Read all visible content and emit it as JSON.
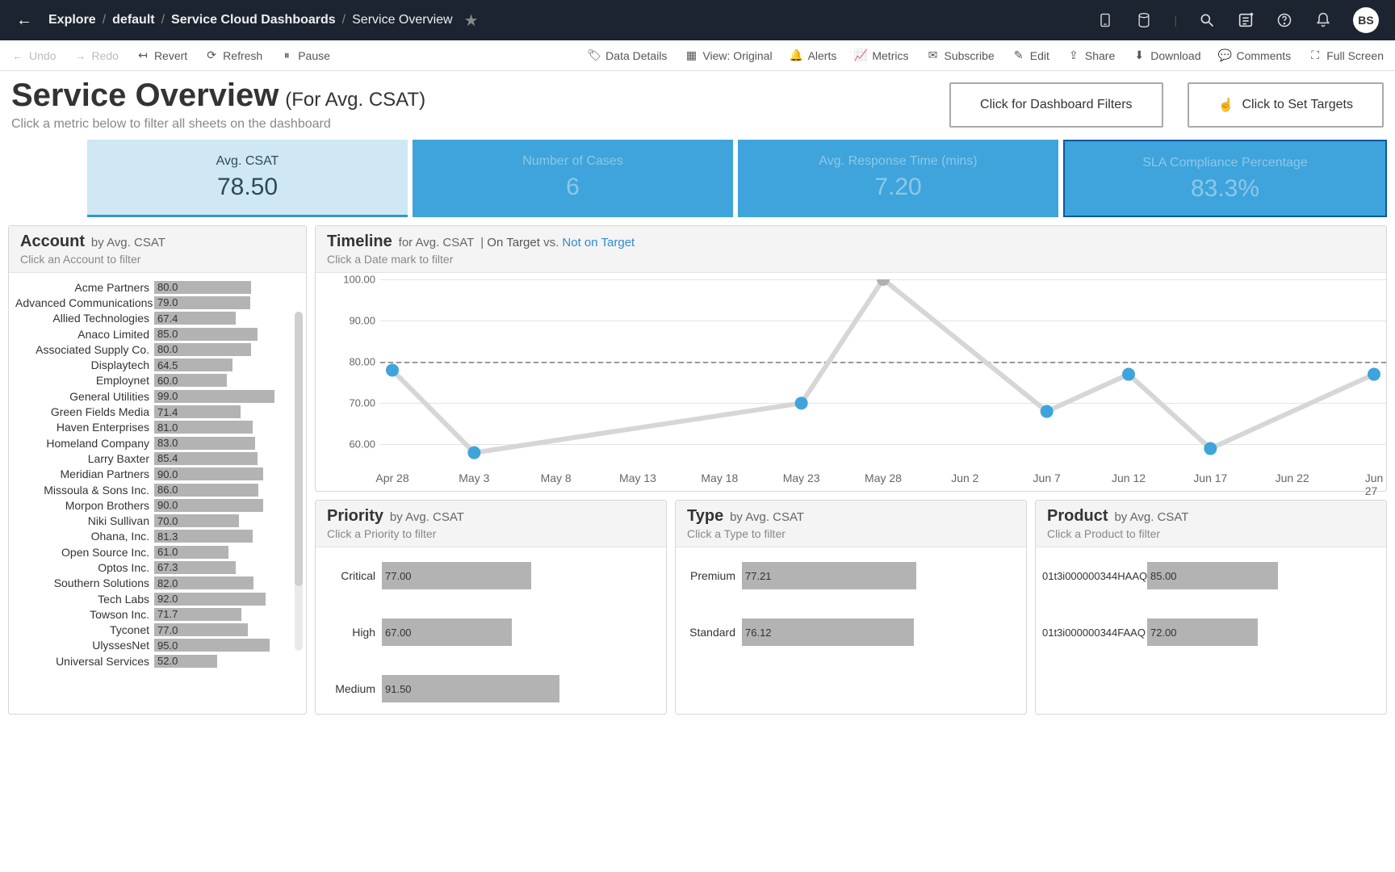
{
  "breadcrumb": {
    "explore": "Explore",
    "default": "default",
    "dash": "Service Cloud Dashboards",
    "page": "Service Overview"
  },
  "avatar": "BS",
  "toolbar": {
    "undo": "Undo",
    "redo": "Redo",
    "revert": "Revert",
    "refresh": "Refresh",
    "pause": "Pause",
    "datadetails": "Data Details",
    "view": "View: Original",
    "alerts": "Alerts",
    "metrics": "Metrics",
    "subscribe": "Subscribe",
    "edit": "Edit",
    "share": "Share",
    "download": "Download",
    "comments": "Comments",
    "fullscreen": "Full Screen"
  },
  "title": "Service Overview",
  "title_sub": "(For Avg. CSAT)",
  "title_hint": "Click a metric below to filter all sheets on the dashboard",
  "btn_filters": "Click for Dashboard Filters",
  "btn_targets": "Click to Set Targets",
  "tiles": [
    {
      "label": "Avg. CSAT",
      "value": "78.50"
    },
    {
      "label": "Number of Cases",
      "value": "6"
    },
    {
      "label": "Avg. Response Time (mins)",
      "value": "7.20"
    },
    {
      "label": "SLA Compliance Percentage",
      "value": "83.3%"
    }
  ],
  "account": {
    "title": "Account",
    "sub": "by Avg. CSAT",
    "hint": "Click an Account to filter",
    "rows": [
      {
        "name": "Acme Partners",
        "v": "80.0"
      },
      {
        "name": "Advanced Communications",
        "v": "79.0"
      },
      {
        "name": "Allied Technologies",
        "v": "67.4"
      },
      {
        "name": "Anaco Limited",
        "v": "85.0"
      },
      {
        "name": "Associated Supply Co.",
        "v": "80.0"
      },
      {
        "name": "Displaytech",
        "v": "64.5"
      },
      {
        "name": "Employnet",
        "v": "60.0"
      },
      {
        "name": "General Utilities",
        "v": "99.0"
      },
      {
        "name": "Green Fields Media",
        "v": "71.4"
      },
      {
        "name": "Haven Enterprises",
        "v": "81.0"
      },
      {
        "name": "Homeland Company",
        "v": "83.0"
      },
      {
        "name": "Larry Baxter",
        "v": "85.4"
      },
      {
        "name": "Meridian Partners",
        "v": "90.0"
      },
      {
        "name": "Missoula & Sons Inc.",
        "v": "86.0"
      },
      {
        "name": "Morpon Brothers",
        "v": "90.0"
      },
      {
        "name": "Niki Sullivan",
        "v": "70.0"
      },
      {
        "name": "Ohana, Inc.",
        "v": "81.3"
      },
      {
        "name": "Open Source Inc.",
        "v": "61.0"
      },
      {
        "name": "Optos Inc.",
        "v": "67.3"
      },
      {
        "name": "Southern Solutions",
        "v": "82.0"
      },
      {
        "name": "Tech Labs",
        "v": "92.0"
      },
      {
        "name": "Towson Inc.",
        "v": "71.7"
      },
      {
        "name": "Tyconet",
        "v": "77.0"
      },
      {
        "name": "UlyssesNet",
        "v": "95.0"
      },
      {
        "name": "Universal Services",
        "v": "52.0"
      }
    ]
  },
  "timeline": {
    "title": "Timeline",
    "sub": "for Avg. CSAT",
    "legend_on": "On Target",
    "legend_vs": "vs.",
    "legend_off": "Not on Target",
    "hint": "Click a Date mark to filter"
  },
  "priority": {
    "title": "Priority",
    "sub": "by Avg. CSAT",
    "hint": "Click a Priority to filter",
    "rows": [
      {
        "name": "Critical",
        "v": "77.00"
      },
      {
        "name": "High",
        "v": "67.00"
      },
      {
        "name": "Medium",
        "v": "91.50"
      }
    ]
  },
  "type": {
    "title": "Type",
    "sub": "by Avg. CSAT",
    "hint": "Click a Type to filter",
    "rows": [
      {
        "name": "Premium",
        "v": "77.21"
      },
      {
        "name": "Standard",
        "v": "76.12"
      }
    ]
  },
  "product": {
    "title": "Product",
    "sub": "by Avg. CSAT",
    "hint": "Click a Product to filter",
    "rows": [
      {
        "name": "01t3i000000344HAAQ",
        "v": "85.00"
      },
      {
        "name": "01t3i000000344FAAQ",
        "v": "72.00"
      }
    ]
  },
  "chart_data": [
    {
      "type": "bar",
      "name": "Account by Avg. CSAT",
      "xlim": [
        0,
        100
      ],
      "categories": [
        "Acme Partners",
        "Advanced Communications",
        "Allied Technologies",
        "Anaco Limited",
        "Associated Supply Co.",
        "Displaytech",
        "Employnet",
        "General Utilities",
        "Green Fields Media",
        "Haven Enterprises",
        "Homeland Company",
        "Larry Baxter",
        "Meridian Partners",
        "Missoula & Sons Inc.",
        "Morpon Brothers",
        "Niki Sullivan",
        "Ohana, Inc.",
        "Open Source Inc.",
        "Optos Inc.",
        "Southern Solutions",
        "Tech Labs",
        "Towson Inc.",
        "Tyconet",
        "UlyssesNet",
        "Universal Services"
      ],
      "values": [
        80.0,
        79.0,
        67.4,
        85.0,
        80.0,
        64.5,
        60.0,
        99.0,
        71.4,
        81.0,
        83.0,
        85.4,
        90.0,
        86.0,
        90.0,
        70.0,
        81.3,
        61.0,
        67.3,
        82.0,
        92.0,
        71.7,
        77.0,
        95.0,
        52.0
      ]
    },
    {
      "type": "line",
      "name": "Timeline for Avg. CSAT",
      "ylim": [
        55,
        100
      ],
      "target": 80,
      "x": [
        "Apr 28",
        "May 3",
        "May 8",
        "May 13",
        "May 18",
        "May 23",
        "May 28",
        "Jun 2",
        "Jun 7",
        "Jun 12",
        "Jun 17",
        "Jun 22",
        "Jun 27"
      ],
      "series": [
        {
          "name": "Avg. CSAT",
          "values": [
            78,
            58,
            null,
            null,
            null,
            70,
            100,
            null,
            68,
            77,
            59,
            null,
            77
          ]
        }
      ],
      "on_target_flags": [
        false,
        false,
        null,
        null,
        null,
        false,
        true,
        null,
        false,
        false,
        false,
        null,
        false
      ]
    },
    {
      "type": "bar",
      "name": "Priority by Avg. CSAT",
      "xlim": [
        0,
        100
      ],
      "categories": [
        "Critical",
        "High",
        "Medium"
      ],
      "values": [
        77.0,
        67.0,
        91.5
      ]
    },
    {
      "type": "bar",
      "name": "Type by Avg. CSAT",
      "xlim": [
        0,
        100
      ],
      "categories": [
        "Premium",
        "Standard"
      ],
      "values": [
        77.21,
        76.12
      ]
    },
    {
      "type": "bar",
      "name": "Product by Avg. CSAT",
      "xlim": [
        0,
        100
      ],
      "categories": [
        "01t3i000000344HAAQ",
        "01t3i000000344FAAQ"
      ],
      "values": [
        85.0,
        72.0
      ]
    }
  ]
}
